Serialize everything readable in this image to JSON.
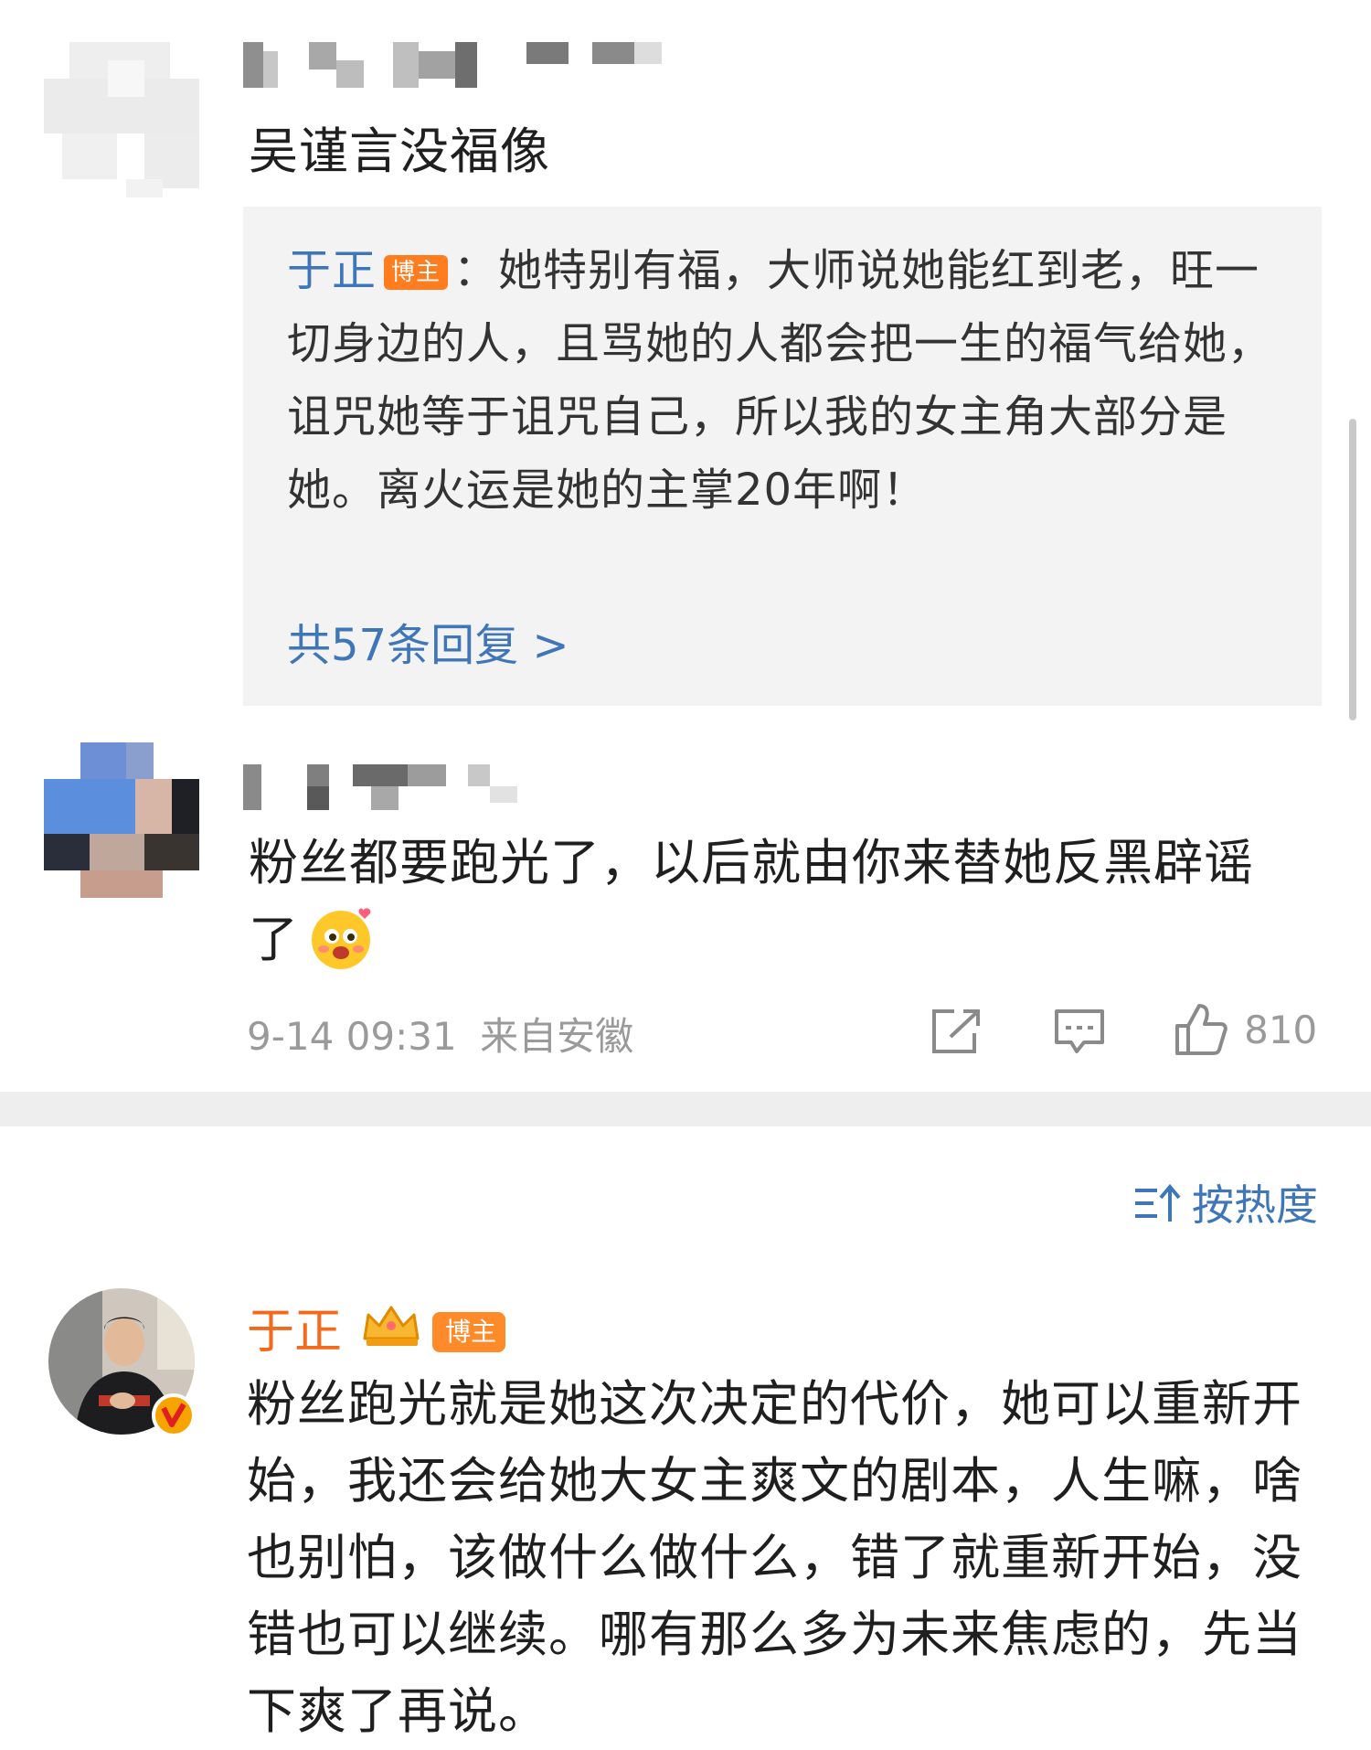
{
  "comment1": {
    "text": "吴谨言没福像"
  },
  "reply": {
    "author": "于正",
    "badge": "博主",
    "separator": "：",
    "text": "她特别有福，大师说她能红到老，旺一切身边的人，且骂她的人都会把一生的福气给她，诅咒她等于诅咒自己，所以我的女主角大部分是她。离火运是她的主掌20年啊！",
    "more_link": "共57条回复 >"
  },
  "comment2": {
    "text": "粉丝都要跑光了，以后就由你来替她反黑辟谣了",
    "emoji": "love-blush-emoji",
    "time": "9-14 09:31",
    "location": "来自安徽",
    "likes": "810"
  },
  "sort": {
    "label": "按热度"
  },
  "comment3": {
    "author": "于正",
    "badge": "博主",
    "text": "粉丝跑光就是她这次决定的代价，她可以重新开始，我还会给她大女主爽文的剧本，人生嘛，啥也别怕，该做什么做什么，错了就重新开始，没错也可以继续。哪有那么多为未来焦虑的，先当下爽了再说。"
  },
  "colors": {
    "link_blue": "#3f76b8",
    "orange": "#f26a1b",
    "reply_bg": "#f3f3f3",
    "meta_gray": "#9a9a9a"
  }
}
